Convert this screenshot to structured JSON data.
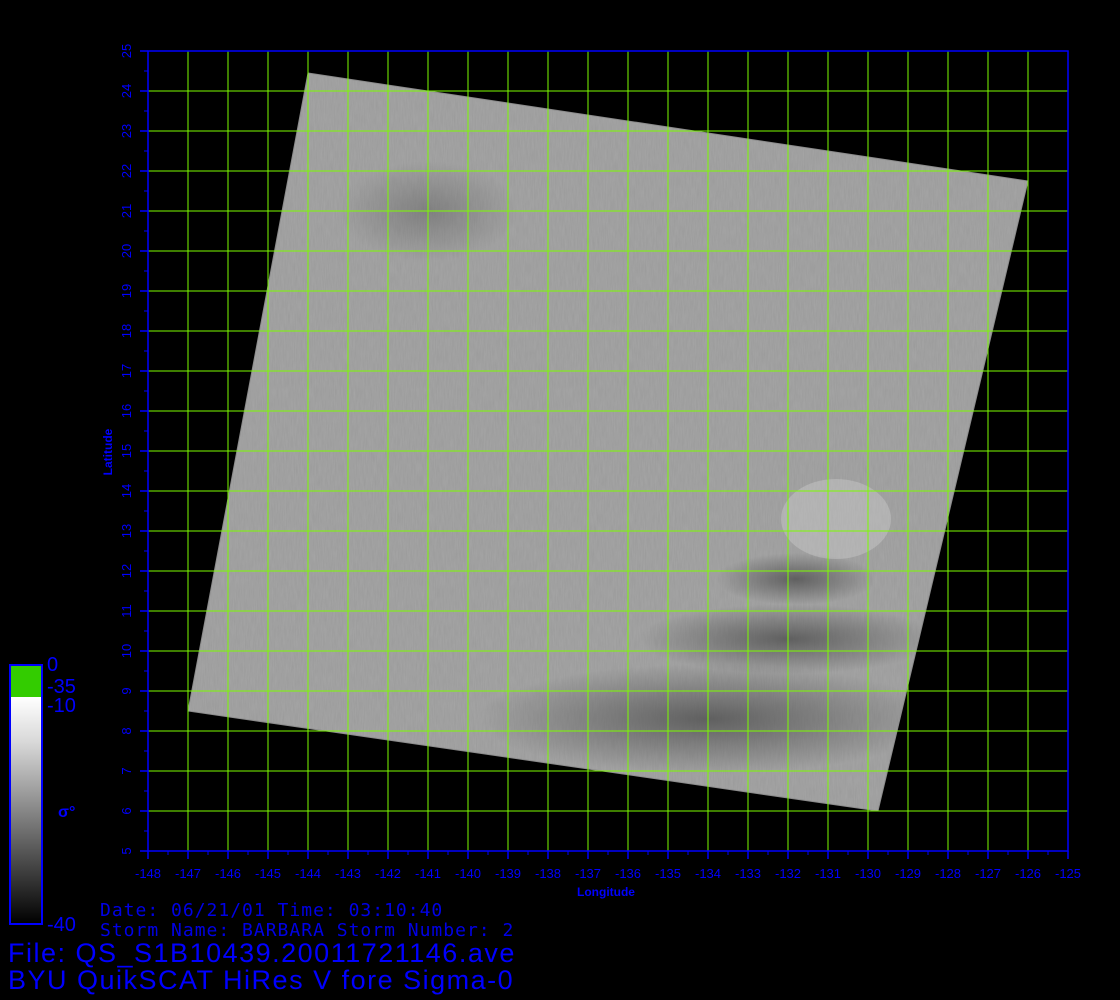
{
  "plot": {
    "xlabel": "Longitude",
    "ylabel": "Latitude",
    "lon_range": [
      -148,
      -125
    ],
    "lat_range": [
      5,
      25
    ],
    "lon_ticks": [
      "-148",
      "-147",
      "-146",
      "-145",
      "-144",
      "-143",
      "-142",
      "-141",
      "-140",
      "-139",
      "-138",
      "-137",
      "-136",
      "-135",
      "-134",
      "-133",
      "-132",
      "-131",
      "-130",
      "-129",
      "-128",
      "-127",
      "-126",
      "-125"
    ],
    "lat_ticks": [
      "5",
      "6",
      "7",
      "8",
      "9",
      "10",
      "11",
      "12",
      "13",
      "14",
      "15",
      "16",
      "17",
      "18",
      "19",
      "20",
      "21",
      "22",
      "23",
      "24",
      "25"
    ],
    "grid": true,
    "grid_color": "#7cfc00",
    "axis_color": "#0000ff",
    "swath_corners": [
      [
        -144.0,
        24.45
      ],
      [
        -126.0,
        21.75
      ],
      [
        -129.75,
        6.0
      ],
      [
        -147.0,
        8.5
      ]
    ]
  },
  "colorbar": {
    "labels": [
      "0",
      "-35",
      "-10",
      "-40"
    ],
    "symbol": "σ°",
    "top_color": "#33cc00"
  },
  "info": {
    "date_line": "Date: 06/21/01   Time: 03:10:40",
    "storm_line": "Storm  Name: BARBARA   Storm  Number: 2"
  },
  "footer": {
    "file_line": "File: QS_S1B10439.20011721146.ave",
    "product_line": "BYU QuikSCAT HiRes V fore Sigma-0"
  }
}
